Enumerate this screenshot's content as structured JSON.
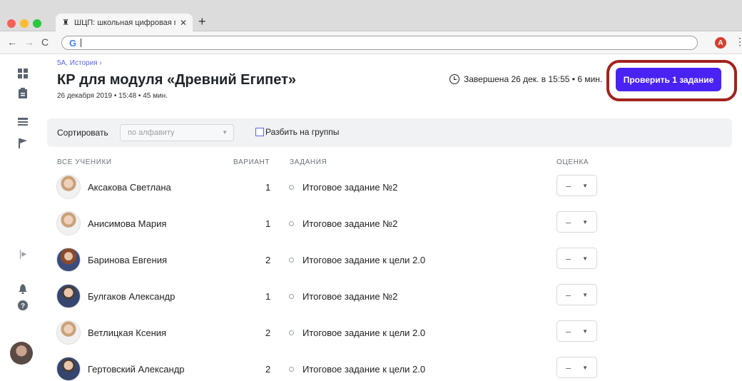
{
  "browser": {
    "tab_title": "ШЦП: школьная цифровая пла",
    "tab_close": "✕",
    "new_tab": "+",
    "address_value": "",
    "profile_initial": "A"
  },
  "header": {
    "breadcrumb": "5А, История ›",
    "title": "КР для модуля «Древний Египет»",
    "subtitle": "26 декабря 2019 • 15:48 • 45 мин.",
    "finished": "Завершена 26 дек. в 15:55 • 6 мин.",
    "check_button": "Проверить 1 задание",
    "accent_color": "#4b22f4",
    "highlight_color": "#a3221e"
  },
  "filters": {
    "sort_label": "Сортировать",
    "sort_value": "по алфавиту",
    "group_label": "Разбить на группы"
  },
  "columns": {
    "students": "ВСЕ УЧЕНИКИ",
    "variant": "ВАРИАНТ",
    "tasks": "ЗАДАНИЯ",
    "grade": "ОЦЕНКА"
  },
  "rows": [
    {
      "name": "Аксакова Светлана",
      "variant": "1",
      "task": "Итоговое задание №2",
      "grade": "–"
    },
    {
      "name": "Анисимова Мария",
      "variant": "1",
      "task": "Итоговое задание №2",
      "grade": "–"
    },
    {
      "name": "Баринова Евгения",
      "variant": "2",
      "task": "Итоговое задание к цели 2.0",
      "grade": "–"
    },
    {
      "name": "Булгаков Александр",
      "variant": "1",
      "task": "Итоговое задание №2",
      "grade": "–"
    },
    {
      "name": "Ветлицкая Ксения",
      "variant": "2",
      "task": "Итоговое задание к цели 2.0",
      "grade": "–"
    },
    {
      "name": "Гертовский Александр",
      "variant": "2",
      "task": "Итоговое задание к цели 2.0",
      "grade": "–"
    }
  ]
}
